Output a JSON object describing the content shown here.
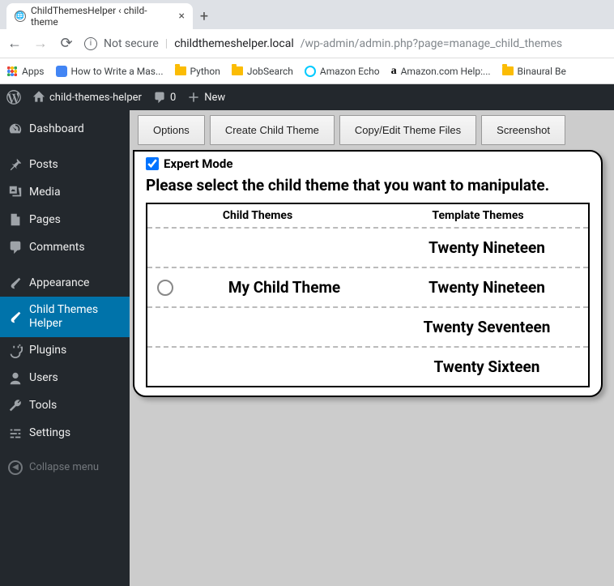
{
  "browser": {
    "tab_title": "ChildThemesHelper ‹ child-theme",
    "not_secure": "Not secure",
    "domain": "childthemeshelper.local",
    "path": "/wp-admin/admin.php?page=manage_child_themes"
  },
  "bookmarks": {
    "apps": "Apps",
    "write_master": "How to Write a Mas...",
    "python": "Python",
    "jobsearch": "JobSearch",
    "amazon_echo": "Amazon Echo",
    "amazon_help": "Amazon.com Help:...",
    "binaural": "Binaural Be"
  },
  "adminbar": {
    "site": "child-themes-helper",
    "comments": "0",
    "new": "New"
  },
  "menu": {
    "dashboard": "Dashboard",
    "posts": "Posts",
    "media": "Media",
    "pages": "Pages",
    "comments": "Comments",
    "appearance": "Appearance",
    "child_helper": "Child Themes Helper",
    "plugins": "Plugins",
    "users": "Users",
    "tools": "Tools",
    "settings": "Settings",
    "collapse": "Collapse menu"
  },
  "tabs": {
    "options": "Options",
    "create": "Create Child Theme",
    "copyedit": "Copy/Edit Theme Files",
    "screenshot": "Screenshot"
  },
  "panel": {
    "expert": "Expert Mode",
    "heading": "Please select the child theme that you want to manipulate.",
    "head_child": "Child Themes",
    "head_template": "Template Themes",
    "rows": [
      {
        "child": "",
        "template": "Twenty Nineteen",
        "radio": false
      },
      {
        "child": "My Child Theme",
        "template": "Twenty Nineteen",
        "radio": true
      },
      {
        "child": "",
        "template": "Twenty Seventeen",
        "radio": false
      },
      {
        "child": "",
        "template": "Twenty Sixteen",
        "radio": false
      }
    ]
  }
}
